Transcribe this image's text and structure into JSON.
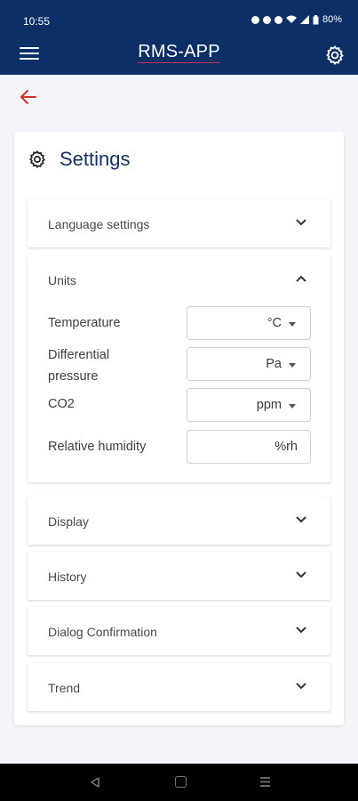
{
  "status_bar": {
    "time": "10:55",
    "battery": "80%"
  },
  "app_bar": {
    "title": "RMS-APP",
    "menu_icon": "hamburger-menu-icon",
    "settings_icon": "gear-icon"
  },
  "back_icon": "arrow-left-icon",
  "settings_card": {
    "title": "Settings",
    "icon": "gear-icon"
  },
  "panels": {
    "language": {
      "label": "Language settings",
      "expanded": false
    },
    "units": {
      "label": "Units",
      "expanded": true,
      "rows": [
        {
          "label": "Temperature",
          "value": "°C",
          "dropdown": true
        },
        {
          "label": "Differential pressure",
          "value": "Pa",
          "dropdown": true
        },
        {
          "label": "CO2",
          "value": "ppm",
          "dropdown": true
        },
        {
          "label": "Relative humidity",
          "value": "%rh",
          "dropdown": false
        }
      ]
    },
    "display": {
      "label": "Display",
      "expanded": false
    },
    "history": {
      "label": "History",
      "expanded": false
    },
    "dialog": {
      "label": "Dialog Confirmation",
      "expanded": false
    },
    "trend": {
      "label": "Trend",
      "expanded": false
    }
  },
  "colors": {
    "app_bar": "#0c2f66",
    "back_arrow": "#d0312d",
    "title_text": "#16305e",
    "page_bg": "#f3f5fa"
  }
}
